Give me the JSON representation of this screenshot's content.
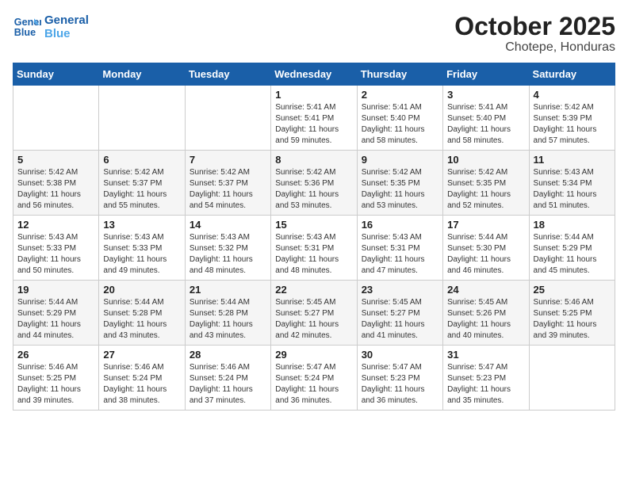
{
  "logo": {
    "line1": "General",
    "line2": "Blue"
  },
  "title": "October 2025",
  "subtitle": "Chotepe, Honduras",
  "weekdays": [
    "Sunday",
    "Monday",
    "Tuesday",
    "Wednesday",
    "Thursday",
    "Friday",
    "Saturday"
  ],
  "weeks": [
    [
      {
        "day": "",
        "info": ""
      },
      {
        "day": "",
        "info": ""
      },
      {
        "day": "",
        "info": ""
      },
      {
        "day": "1",
        "info": "Sunrise: 5:41 AM\nSunset: 5:41 PM\nDaylight: 11 hours\nand 59 minutes."
      },
      {
        "day": "2",
        "info": "Sunrise: 5:41 AM\nSunset: 5:40 PM\nDaylight: 11 hours\nand 58 minutes."
      },
      {
        "day": "3",
        "info": "Sunrise: 5:41 AM\nSunset: 5:40 PM\nDaylight: 11 hours\nand 58 minutes."
      },
      {
        "day": "4",
        "info": "Sunrise: 5:42 AM\nSunset: 5:39 PM\nDaylight: 11 hours\nand 57 minutes."
      }
    ],
    [
      {
        "day": "5",
        "info": "Sunrise: 5:42 AM\nSunset: 5:38 PM\nDaylight: 11 hours\nand 56 minutes."
      },
      {
        "day": "6",
        "info": "Sunrise: 5:42 AM\nSunset: 5:37 PM\nDaylight: 11 hours\nand 55 minutes."
      },
      {
        "day": "7",
        "info": "Sunrise: 5:42 AM\nSunset: 5:37 PM\nDaylight: 11 hours\nand 54 minutes."
      },
      {
        "day": "8",
        "info": "Sunrise: 5:42 AM\nSunset: 5:36 PM\nDaylight: 11 hours\nand 53 minutes."
      },
      {
        "day": "9",
        "info": "Sunrise: 5:42 AM\nSunset: 5:35 PM\nDaylight: 11 hours\nand 53 minutes."
      },
      {
        "day": "10",
        "info": "Sunrise: 5:42 AM\nSunset: 5:35 PM\nDaylight: 11 hours\nand 52 minutes."
      },
      {
        "day": "11",
        "info": "Sunrise: 5:43 AM\nSunset: 5:34 PM\nDaylight: 11 hours\nand 51 minutes."
      }
    ],
    [
      {
        "day": "12",
        "info": "Sunrise: 5:43 AM\nSunset: 5:33 PM\nDaylight: 11 hours\nand 50 minutes."
      },
      {
        "day": "13",
        "info": "Sunrise: 5:43 AM\nSunset: 5:33 PM\nDaylight: 11 hours\nand 49 minutes."
      },
      {
        "day": "14",
        "info": "Sunrise: 5:43 AM\nSunset: 5:32 PM\nDaylight: 11 hours\nand 48 minutes."
      },
      {
        "day": "15",
        "info": "Sunrise: 5:43 AM\nSunset: 5:31 PM\nDaylight: 11 hours\nand 48 minutes."
      },
      {
        "day": "16",
        "info": "Sunrise: 5:43 AM\nSunset: 5:31 PM\nDaylight: 11 hours\nand 47 minutes."
      },
      {
        "day": "17",
        "info": "Sunrise: 5:44 AM\nSunset: 5:30 PM\nDaylight: 11 hours\nand 46 minutes."
      },
      {
        "day": "18",
        "info": "Sunrise: 5:44 AM\nSunset: 5:29 PM\nDaylight: 11 hours\nand 45 minutes."
      }
    ],
    [
      {
        "day": "19",
        "info": "Sunrise: 5:44 AM\nSunset: 5:29 PM\nDaylight: 11 hours\nand 44 minutes."
      },
      {
        "day": "20",
        "info": "Sunrise: 5:44 AM\nSunset: 5:28 PM\nDaylight: 11 hours\nand 43 minutes."
      },
      {
        "day": "21",
        "info": "Sunrise: 5:44 AM\nSunset: 5:28 PM\nDaylight: 11 hours\nand 43 minutes."
      },
      {
        "day": "22",
        "info": "Sunrise: 5:45 AM\nSunset: 5:27 PM\nDaylight: 11 hours\nand 42 minutes."
      },
      {
        "day": "23",
        "info": "Sunrise: 5:45 AM\nSunset: 5:27 PM\nDaylight: 11 hours\nand 41 minutes."
      },
      {
        "day": "24",
        "info": "Sunrise: 5:45 AM\nSunset: 5:26 PM\nDaylight: 11 hours\nand 40 minutes."
      },
      {
        "day": "25",
        "info": "Sunrise: 5:46 AM\nSunset: 5:25 PM\nDaylight: 11 hours\nand 39 minutes."
      }
    ],
    [
      {
        "day": "26",
        "info": "Sunrise: 5:46 AM\nSunset: 5:25 PM\nDaylight: 11 hours\nand 39 minutes."
      },
      {
        "day": "27",
        "info": "Sunrise: 5:46 AM\nSunset: 5:24 PM\nDaylight: 11 hours\nand 38 minutes."
      },
      {
        "day": "28",
        "info": "Sunrise: 5:46 AM\nSunset: 5:24 PM\nDaylight: 11 hours\nand 37 minutes."
      },
      {
        "day": "29",
        "info": "Sunrise: 5:47 AM\nSunset: 5:24 PM\nDaylight: 11 hours\nand 36 minutes."
      },
      {
        "day": "30",
        "info": "Sunrise: 5:47 AM\nSunset: 5:23 PM\nDaylight: 11 hours\nand 36 minutes."
      },
      {
        "day": "31",
        "info": "Sunrise: 5:47 AM\nSunset: 5:23 PM\nDaylight: 11 hours\nand 35 minutes."
      },
      {
        "day": "",
        "info": ""
      }
    ]
  ]
}
